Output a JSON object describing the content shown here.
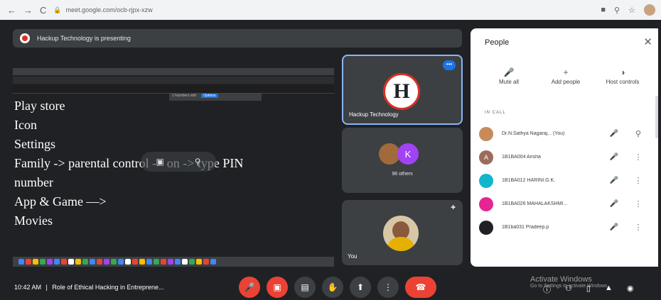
{
  "browser": {
    "url": "meet.google.com/ocb-rjpx-xzw",
    "nav_back": "←",
    "nav_forward": "→",
    "reload": "C"
  },
  "presenting": {
    "text": "Hackup Technology is presenting"
  },
  "shared_screen": {
    "find_text": "1 Numbers edit",
    "find_button": "Options",
    "lines": [
      "Play store",
      "Icon",
      "Settings",
      "Family -> parental control -> on -> type PIN",
      "number",
      "App & Game —>",
      "Movies"
    ],
    "dock_colors": [
      "#4285f4",
      "#ea4335",
      "#fbbc04",
      "#34a853",
      "#a142f4",
      "#4285f4",
      "#ea4335",
      "#ffffff",
      "#fbbc04",
      "#34a853",
      "#4285f4",
      "#ea4335",
      "#a142f4",
      "#34a853",
      "#4285f4",
      "#ffffff",
      "#ea4335",
      "#fbbc04",
      "#4285f4",
      "#34a853",
      "#ea4335",
      "#a142f4",
      "#4285f4",
      "#ffffff",
      "#34a853",
      "#fbbc04",
      "#ea4335",
      "#4285f4"
    ]
  },
  "tiles": {
    "presenter_name": "Hackup Technology",
    "presenter_logo": "H",
    "more_label": "•••",
    "others_avatar_letter": "K",
    "others_label": "96 others",
    "you_label": "You"
  },
  "people_panel": {
    "title": "People",
    "close": "✕",
    "actions": [
      {
        "label": "Mute all",
        "icon": "mic-off-icon"
      },
      {
        "label": "Add people",
        "icon": "add-person-icon"
      },
      {
        "label": "Host controls",
        "icon": "toggle-icon"
      }
    ],
    "section_label": "IN CALL",
    "participants": [
      {
        "name": "Dr.N.Sathya Nagaraj... (You)",
        "avatar": "",
        "color": "#c98a5a",
        "action": "pin"
      },
      {
        "name": "1B1BA004 Arisha",
        "avatar": "A",
        "color": "#9a6d5a",
        "action": "more"
      },
      {
        "name": "1B1BA012 HARINI.G.K.",
        "avatar": "",
        "color": "#12b5cb",
        "action": "more"
      },
      {
        "name": "1B1BA026 MAHALAKSHMI...",
        "avatar": "",
        "color": "#e52592",
        "action": "more"
      },
      {
        "name": "1B1ba031 Pradeep.p",
        "avatar": "",
        "color": "#202124",
        "action": "more"
      }
    ]
  },
  "bottom_bar": {
    "time": "10:42 AM",
    "separator": "|",
    "meeting_title": "Role of Ethical Hacking in Entreprene..."
  },
  "watermark": {
    "title": "Activate Windows",
    "subtitle": "Go to Settings to activate Windows."
  }
}
